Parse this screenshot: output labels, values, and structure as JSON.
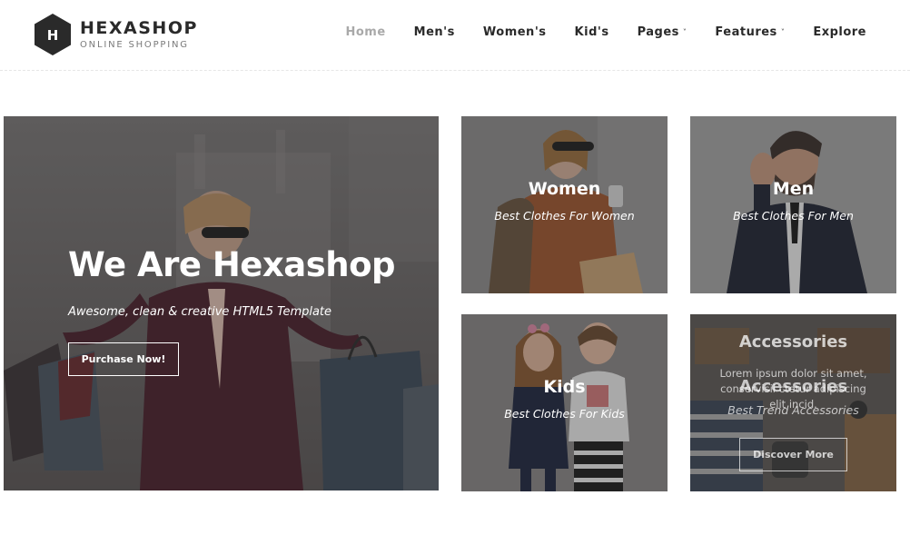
{
  "brand": {
    "logo_letter": "H",
    "name": "HEXASHOP",
    "tagline": "ONLINE SHOPPING"
  },
  "nav": {
    "items": [
      {
        "label": "Home",
        "active": true,
        "dropdown": false
      },
      {
        "label": "Men's",
        "active": false,
        "dropdown": false
      },
      {
        "label": "Women's",
        "active": false,
        "dropdown": false
      },
      {
        "label": "Kid's",
        "active": false,
        "dropdown": false
      },
      {
        "label": "Pages",
        "active": false,
        "dropdown": true
      },
      {
        "label": "Features",
        "active": false,
        "dropdown": true
      },
      {
        "label": "Explore",
        "active": false,
        "dropdown": false
      }
    ],
    "caret_glyph": "˅"
  },
  "hero": {
    "title": "We Are Hexashop",
    "subtitle": "Awesome, clean & creative HTML5 Template",
    "button_label": "Purchase Now!"
  },
  "categories": {
    "women": {
      "title": "Women",
      "subtitle": "Best Clothes For Women"
    },
    "men": {
      "title": "Men",
      "subtitle": "Best Clothes For Men"
    },
    "kids": {
      "title": "Kids",
      "subtitle": "Best Clothes For Kids"
    },
    "accessories": {
      "title": "Accessories",
      "subtitle": "Best Trend Accessories",
      "hover_title": "Accessories",
      "hover_description": "Lorem ipsum dolor sit amet, conservisii ctetur adipiscing elit incid.",
      "button_label": "Discover More"
    }
  },
  "colors": {
    "text_dark": "#2a2a2a",
    "nav_active": "#a9a9a9",
    "logo_hex": "#2a2a2a",
    "overlay": "#282828"
  }
}
